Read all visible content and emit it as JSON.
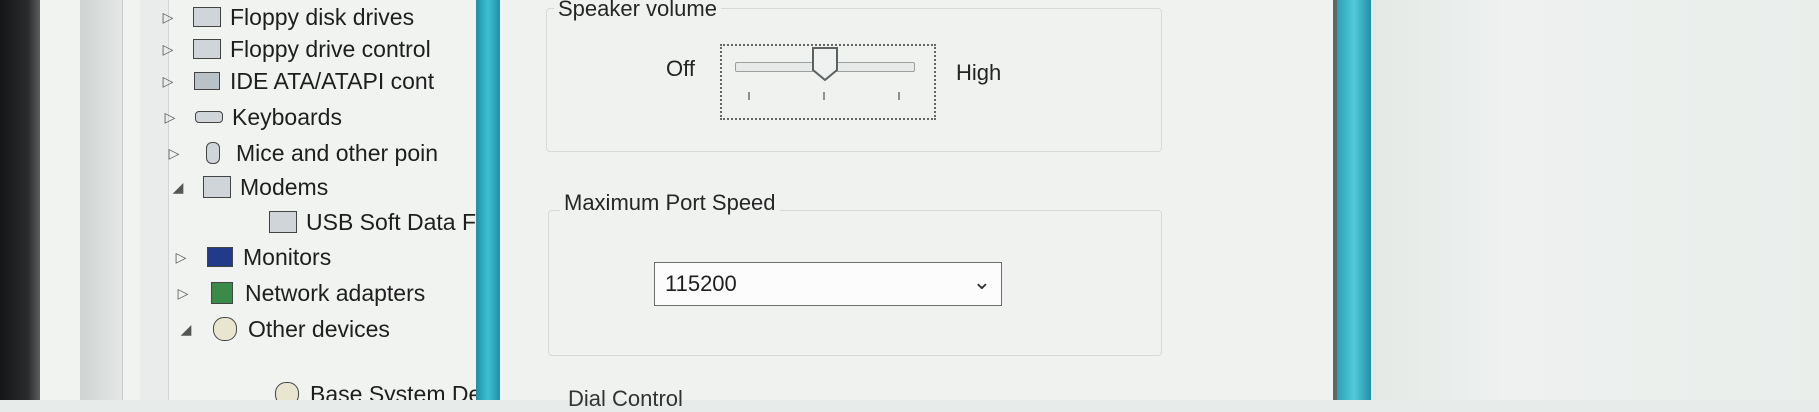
{
  "device_tree": {
    "items": [
      {
        "label": "Floppy disk drives",
        "expander": "▷",
        "icon": "floppy-drive-icon"
      },
      {
        "label": "Floppy drive control",
        "expander": "▷",
        "icon": "floppy-controller-icon"
      },
      {
        "label": "IDE ATA/ATAPI cont",
        "expander": "▷",
        "icon": "ide-controller-icon"
      },
      {
        "label": "Keyboards",
        "expander": "▷",
        "icon": "keyboard-icon"
      },
      {
        "label": "Mice and other poin",
        "expander": "▷",
        "icon": "mouse-icon"
      },
      {
        "label": "Modems",
        "expander": "◢",
        "icon": "modem-icon"
      },
      {
        "label": "USB Soft Data Fa",
        "expander": "",
        "icon": "modem-icon"
      },
      {
        "label": "Monitors",
        "expander": "▷",
        "icon": "monitor-icon"
      },
      {
        "label": "Network adapters",
        "expander": "▷",
        "icon": "network-adapter-icon"
      },
      {
        "label": "Other devices",
        "expander": "◢",
        "icon": "unknown-device-icon"
      },
      {
        "label": "Base System Dev",
        "expander": "",
        "icon": "unknown-device-icon"
      }
    ]
  },
  "speaker_volume": {
    "group_label": "Speaker volume",
    "min_label": "Off",
    "max_label": "High",
    "level": 0.5
  },
  "port_speed": {
    "group_label": "Maximum Port Speed",
    "selected_value": "115200"
  },
  "dial_control": {
    "group_label_partial": "Dial Control"
  },
  "colors": {
    "window_border": "#3fc0d3",
    "dialog_bg": "#f0f2f0"
  }
}
